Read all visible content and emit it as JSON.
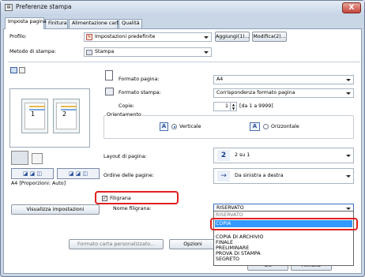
{
  "window": {
    "title": "Preferenze stampa",
    "close_label": "X"
  },
  "tabs": [
    {
      "label": "Imposta pagina"
    },
    {
      "label": "Finitura"
    },
    {
      "label": "Alimentazione carta"
    },
    {
      "label": "Qualità"
    }
  ],
  "profile": {
    "label": "Profilo:",
    "value": "Impostazioni predefinite",
    "add_button": "Aggiungi(1)...",
    "edit_button": "Modifica(2)..."
  },
  "output_method": {
    "label": "Metodo di stampa:",
    "value": "Stampa"
  },
  "page_size": {
    "label": "Formato pagina:",
    "value": "A4"
  },
  "output_size": {
    "label": "Formato stampa:",
    "value": "Corrispondenza formato pagina"
  },
  "copies": {
    "label": "Copie:",
    "value": "1",
    "range": "[da 1 a 9999]"
  },
  "orientation": {
    "label": "Orientamento",
    "portrait": "Verticale",
    "landscape": "Orizzontale",
    "selected": "portrait"
  },
  "preview": {
    "page_numbers": [
      "1",
      "2"
    ],
    "caption": "A4 [Proporzioni: Auto]"
  },
  "layout": {
    "label": "Layout di pagina:",
    "value": "2 su 1",
    "icon_text": "2"
  },
  "page_order": {
    "label": "Ordine delle pagine:",
    "value": "Da sinistra a destra"
  },
  "watermark": {
    "checkbox_label": "Filigrana",
    "checked": true,
    "name_label": "Nome filigrana:",
    "selected": "RISERVATO",
    "options": [
      "RISERVATO",
      "COPIA",
      "COPIA DI ARCHIVIO",
      "FINALE",
      "PRELIMINARE",
      "PROVA DI STAMPA",
      "SEGRETO"
    ],
    "highlighted": "COPIA"
  },
  "buttons": {
    "view_settings": "Visualizza impostazioni",
    "custom_paper": "Formato carta personalizzato...",
    "options": "Opzioni",
    "ok": "OK",
    "cancel": "Annulla"
  },
  "colors": {
    "highlight": "#3399ff",
    "callout": "#e02020"
  }
}
